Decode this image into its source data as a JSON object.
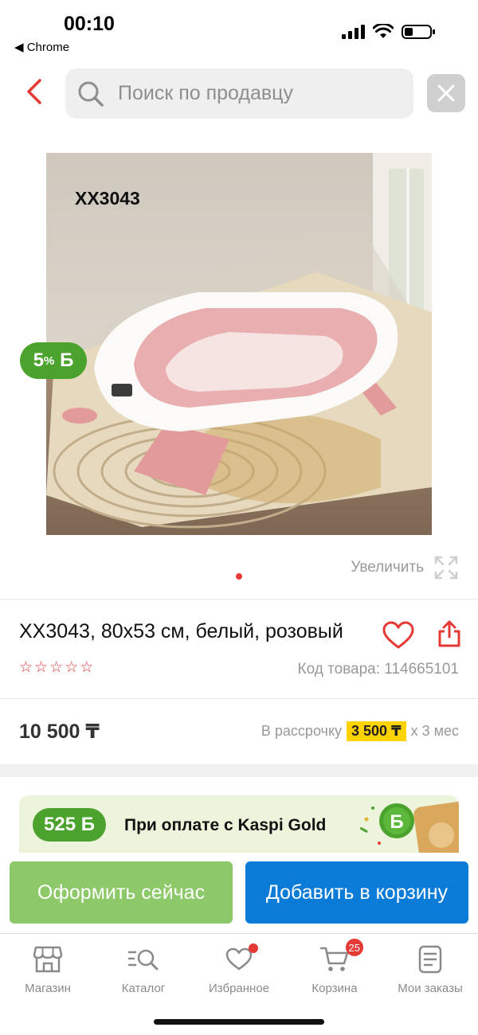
{
  "status_bar": {
    "time": "00:10",
    "back_app": "◀ Chrome"
  },
  "search": {
    "placeholder": "Поиск по продавцу"
  },
  "product": {
    "image_label": "XX3043",
    "bonus_percent": "5",
    "bonus_suffix": "%",
    "bonus_currency": "Б",
    "zoom_label": "Увеличить",
    "title": "XX3043, 80x53 см, белый, розовый",
    "rating_stars": 0,
    "code_label": "Код товара: 114665101",
    "price": "10 500 ₸",
    "installment_prefix": "В рассрочку",
    "installment_amount": "3 500 ₸",
    "installment_suffix": "х 3 мес"
  },
  "kaspi": {
    "bonus": "525 Б",
    "text": "При оплате с Kaspi Gold"
  },
  "actions": {
    "buy_now": "Оформить сейчас",
    "add_to_cart": "Добавить в корзину"
  },
  "tabs": [
    {
      "label": "Магазин",
      "icon": "store-icon"
    },
    {
      "label": "Каталог",
      "icon": "catalog-search-icon"
    },
    {
      "label": "Избранное",
      "icon": "heart-icon"
    },
    {
      "label": "Корзина",
      "icon": "cart-icon",
      "badge": "25"
    },
    {
      "label": "Мои заказы",
      "icon": "orders-icon"
    }
  ],
  "colors": {
    "accent_red": "#e53935",
    "kaspi_green": "#4ba22c",
    "buy_now_green": "#8dc969",
    "cart_blue": "#0b7bd8",
    "installment_yellow": "#ffd200"
  }
}
